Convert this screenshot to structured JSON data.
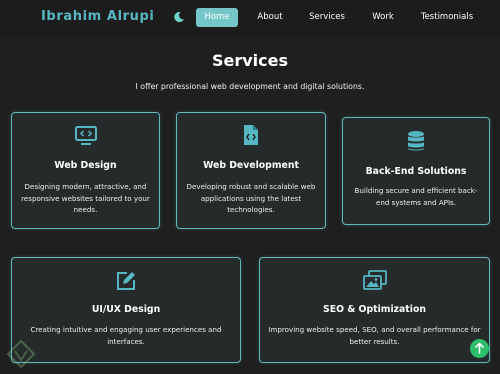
{
  "brand": {
    "name": "Ibrahim Alrupi",
    "accent": "#56b6c2"
  },
  "nav": {
    "theme_toggle_icon": "moon-icon",
    "items": [
      {
        "label": "Home",
        "active": true
      },
      {
        "label": "About"
      },
      {
        "label": "Services"
      },
      {
        "label": "Work"
      },
      {
        "label": "Testimonials"
      }
    ]
  },
  "services": {
    "title": "Services",
    "subtitle": "I offer professional web development and digital solutions.",
    "cards": [
      {
        "icon": "code-monitor-icon",
        "title": "Web Design",
        "desc": "Designing modern, attractive, and responsive websites tailored to your needs."
      },
      {
        "icon": "code-file-icon",
        "title": "Web Development",
        "desc": "Developing robust and scalable web applications using the latest technologies."
      },
      {
        "icon": "database-icon",
        "title": "Back-End Solutions",
        "desc": "Building secure and efficient back-end systems and APIs."
      },
      {
        "icon": "edit-pen-icon",
        "title": "UI/UX Design",
        "desc": "Creating intuitive and engaging user experiences and interfaces."
      },
      {
        "icon": "images-icon",
        "title": "SEO & Optimization",
        "desc": "Improving website speed, SEO, and overall performance for better results."
      }
    ]
  },
  "scroll_top": {
    "icon": "arrow-up-icon",
    "color": "#2ebd6b"
  }
}
